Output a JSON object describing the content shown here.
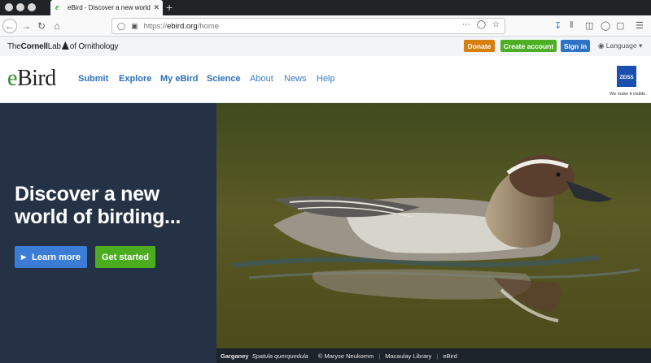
{
  "browser": {
    "tab_title": "eBird - Discover a new world of",
    "tab_close": "✕",
    "new_tab": "+",
    "url_prefix": "https://",
    "url_host": "ebird.org",
    "url_path": "/home"
  },
  "topbar": {
    "logo_bold1": "The",
    "logo_bold2": "Cornell",
    "logo_rest": "Lab",
    "logo_of": "of Ornithology",
    "donate": "Donate",
    "create_account": "Create account",
    "sign_in": "Sign in",
    "language": "Language"
  },
  "header": {
    "logo_e": "e",
    "logo_rest": "Bird",
    "nav": [
      "Submit",
      "Explore",
      "My eBird",
      "Science",
      "About",
      "News",
      "Help"
    ],
    "sponsor_name": "ZEISS",
    "sponsor_tagline": "We make it visible."
  },
  "hero": {
    "headline": "Discover a new world of birding...",
    "learn_more": "Learn more",
    "get_started": "Get started"
  },
  "photo_caption": {
    "common_name": "Garganey",
    "scientific_name": "Spatula querquedula",
    "credit": "© Maryse Neukomm",
    "source": "Macaulay Library",
    "brand": "eBird"
  },
  "colors": {
    "hero_bg": "#253246",
    "donate": "#d47f0e",
    "create_account": "#4caf24",
    "sign_in": "#2f72c4",
    "learn_more": "#3b7dd6",
    "get_started": "#4cac1f",
    "nav_link": "#2f6fbd"
  },
  "icons": [
    "back-icon",
    "forward-icon",
    "reload-icon",
    "home-icon",
    "shield-icon",
    "lock-icon",
    "more-icon",
    "pocket-icon",
    "bookmark-star-icon",
    "download-icon",
    "library-icon",
    "sidebar-icon",
    "account-icon",
    "extension-icon",
    "menu-icon",
    "globe-icon",
    "play-icon"
  ]
}
